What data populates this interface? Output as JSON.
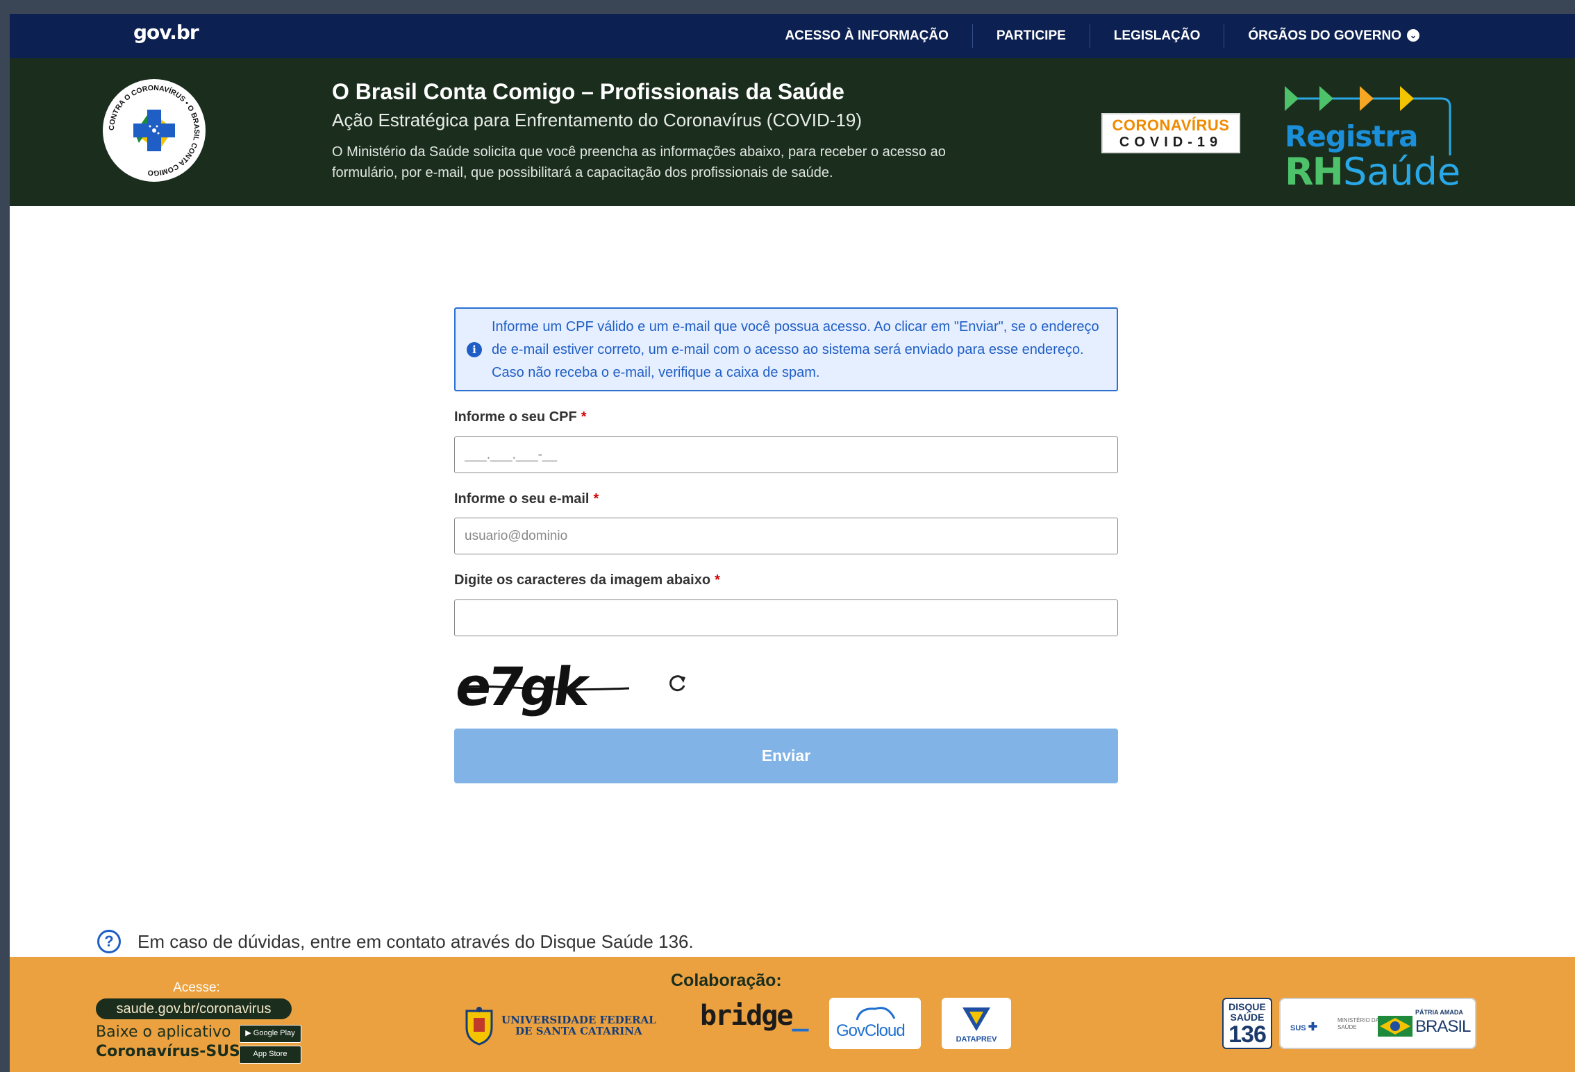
{
  "govbar": {
    "logo": "gov.br",
    "links": [
      "ACESSO À INFORMAÇÃO",
      "PARTICIPE",
      "LEGISLAÇÃO",
      "ÓRGÃOS DO GOVERNO"
    ]
  },
  "header": {
    "seal_text": "CONTRA O CORONAVÍRUS • O BRASIL CONTA COMIGO",
    "title": "O Brasil Conta Comigo – Profissionais da Saúde",
    "subtitle": "Ação Estratégica para Enfrentamento do Coronavírus (COVID-19)",
    "description": "O Ministério da Saúde solicita que você preencha as informações abaixo, para receber o acesso ao formulário, por e-mail, que possibilitará a capacitação dos profissionais de saúde.",
    "badge_line1": "CORONAVÍRUS",
    "badge_line2": "COVID-19",
    "brand_word": "Registra",
    "brand_rh": "RH",
    "brand_saude": "Saúde"
  },
  "form": {
    "info": "Informe um CPF válido e um e-mail que você possua acesso. Ao clicar em \"Enviar\", se o endereço de e-mail estiver correto, um e-mail com o acesso ao sistema será enviado para esse endereço. Caso não receba o e-mail, verifique a caixa de spam.",
    "cpf_label": "Informe o seu CPF",
    "cpf_placeholder": "___.___.___-__",
    "email_label": "Informe o seu e-mail",
    "email_placeholder": "usuario@dominio",
    "captcha_label": "Digite os caracteres da imagem abaixo",
    "captcha_value": "",
    "captcha_image_text": "e7gk",
    "required_mark": "*",
    "submit_label": "Enviar"
  },
  "help": {
    "text": "Em caso de dúvidas, entre em contato através do Disque Saúde 136."
  },
  "footer": {
    "acesse": "Acesse:",
    "link": "saude.gov.br/coronavirus",
    "baixe": "Baixe o aplicativo",
    "app_name": "Coronavírus-SUS",
    "google_play": "▶ Google Play",
    "app_store": " App Store",
    "colab_title": "Colaboração:",
    "ufsc": "UNIVERSIDADE FEDERAL\nDE SANTA CATARINA",
    "bridge": "bridge",
    "govcloud": "GovCloud",
    "dataprev": "DATAPREV",
    "disque_1": "DISQUE",
    "disque_2": "SAÚDE",
    "disque_3": "136",
    "sus": "SUS",
    "ministerio": "MINISTÉRIO DA SAÚDE",
    "patria": "PÁTRIA AMADA",
    "brasil": "BRASIL"
  },
  "colors": {
    "govbar": "#0c2052",
    "header": "#1b2e1d",
    "accent_blue": "#1f5ec4",
    "button_disabled": "#81b3e7",
    "footer": "#eba13f"
  }
}
